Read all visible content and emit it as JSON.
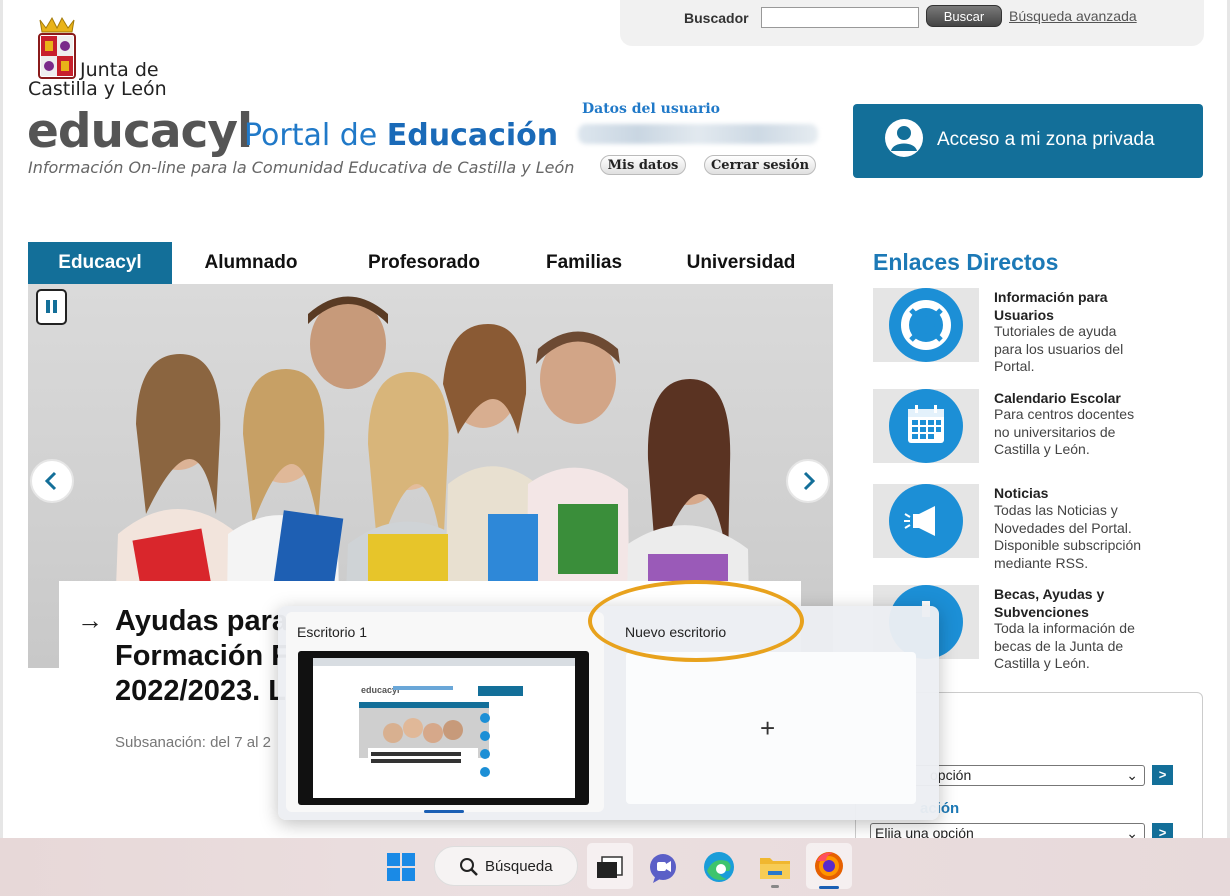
{
  "header": {
    "search_label": "Buscador",
    "search_value": "",
    "search_button": "Buscar",
    "advanced_search": "Búsqueda avanzada"
  },
  "logo": {
    "junta_line1": "Junta de",
    "junta_line2": "Castilla y León",
    "educacyl": "educacyl",
    "portal_prefix": "Portal de ",
    "portal_bold": "Educación",
    "tagline": "Información On-line para la Comunidad Educativa de Castilla y León"
  },
  "user": {
    "title": "Datos del usuario",
    "my_data": "Mis datos",
    "logout": "Cerrar sesión",
    "private_zone": "Acceso a mi zona privada"
  },
  "nav": {
    "items": [
      "Educacyl",
      "Alumnado",
      "Profesorado",
      "Familias",
      "Universidad"
    ],
    "active": "Educacyl"
  },
  "slider": {
    "title": "Ayudas para\nFormación F\n2022/2023. L",
    "subtitle": "Subsanación: del 7 al 2"
  },
  "links": {
    "title": "Enlaces Directos",
    "items": [
      {
        "title": "Información para Usuarios",
        "desc": "Tutoriales de ayuda para los usuarios del Portal.",
        "icon": "lifebuoy-icon"
      },
      {
        "title": "Calendario Escolar",
        "desc": "Para centros docentes no universitarios de Castilla y León.",
        "icon": "calendar-icon"
      },
      {
        "title": "Noticias",
        "desc": "Todas las Noticias y Novedades del Portal. Disponible subscripción mediante RSS.",
        "icon": "megaphone-icon"
      },
      {
        "title": "Becas, Ayudas y Subvenciones",
        "desc": "Toda la información de becas de la Junta de Castilla y León.",
        "icon": "info-icon"
      }
    ]
  },
  "side": {
    "select1": "opción",
    "heading2": "ación",
    "select2": "Elija una opción",
    "go": ">"
  },
  "taskview": {
    "desktop1": "Escritorio 1",
    "new_desktop": "Nuevo escritorio",
    "plus": "+"
  },
  "taskbar": {
    "search": "Búsqueda"
  },
  "colors": {
    "accent": "#136f99",
    "link_blue": "#1c79b6",
    "highlight": "#e8a21d"
  }
}
